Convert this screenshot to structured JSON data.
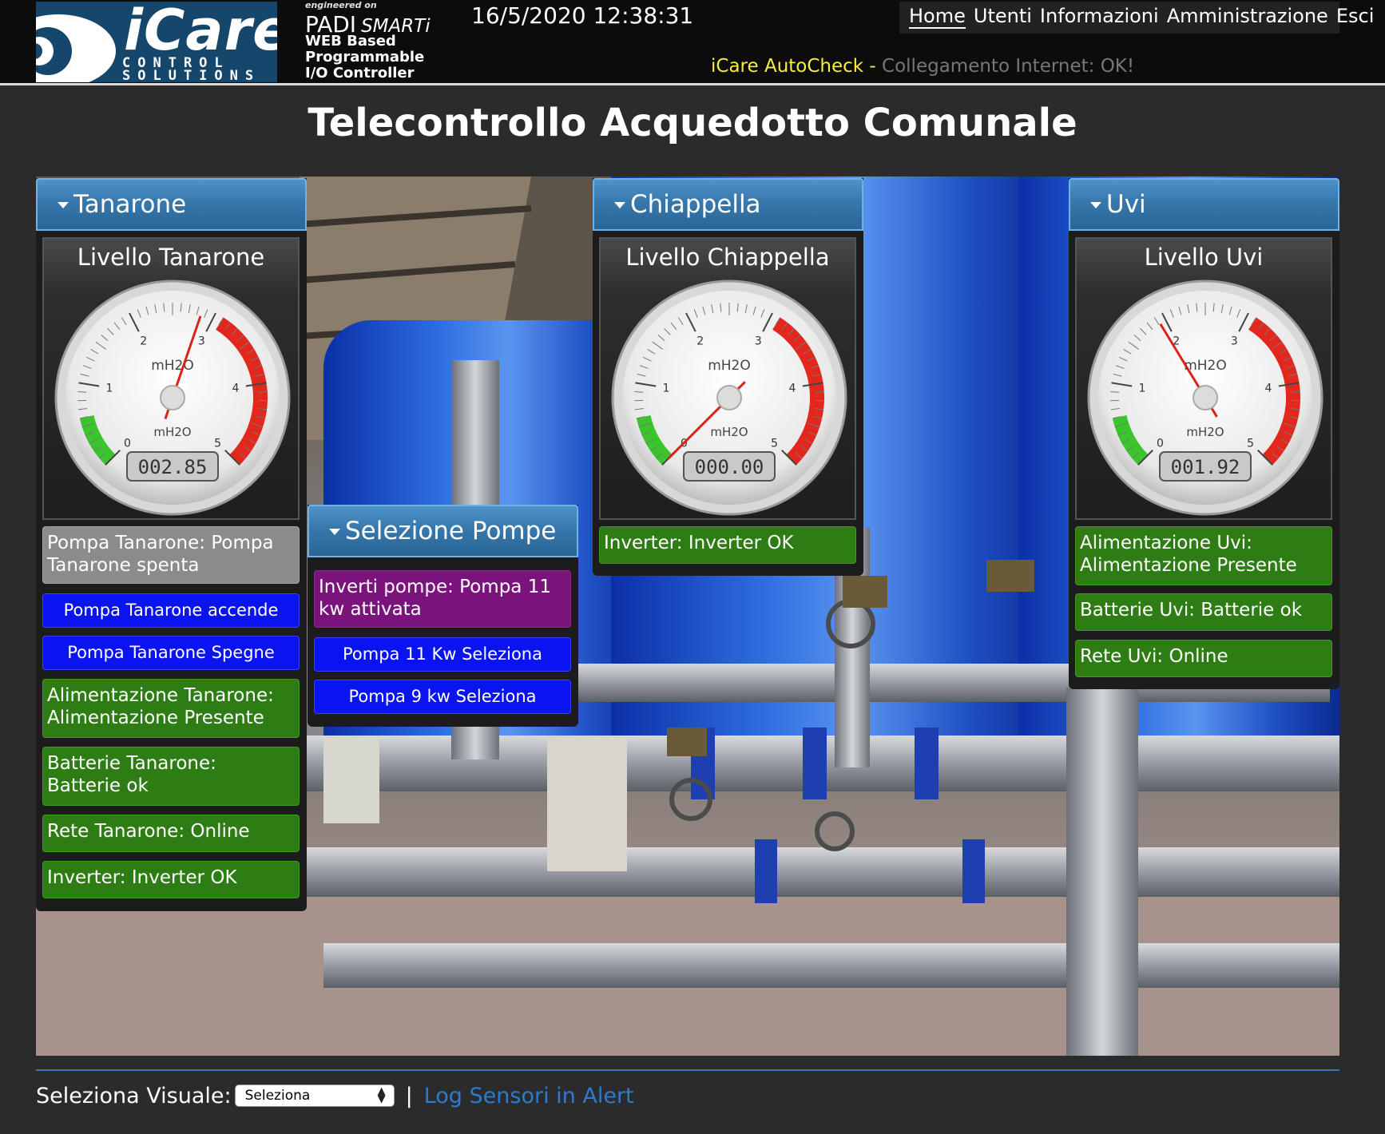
{
  "header": {
    "logo": {
      "name": "iCare",
      "sub1": "CONTROL",
      "sub2": "SOLUTIONS"
    },
    "padi": {
      "engineered": "engineered on",
      "name": "PADI",
      "smart": "SMARTi",
      "desc1": "WEB Based",
      "desc2": "Programmable",
      "desc3": "I/O Controller"
    },
    "datetime": "16/5/2020 12:38:31",
    "nav": [
      "Home",
      "Utenti",
      "Informazioni",
      "Amministrazione",
      "Esci"
    ],
    "autocheck": {
      "label": "iCare AutoCheck - ",
      "status": "Collegamento Internet: OK!"
    }
  },
  "page_title": "Telecontrollo Acquedotto Comunale",
  "panels": {
    "tanarone": {
      "title": "Tanarone",
      "gauge": {
        "title": "Livello Tanarone",
        "unit": "mH2O",
        "readout": "002.85",
        "value": 2.85,
        "min": 0,
        "max": 5
      },
      "pump_status": "Pompa Tanarone: Pompa Tanarone spenta",
      "btn_on": "Pompa Tanarone accende",
      "btn_off": "Pompa Tanarone Spegne",
      "power": "Alimentazione Tanarone: Alimentazione Presente",
      "battery": "Batterie Tanarone: Batterie ok",
      "network": "Rete Tanarone: Online",
      "inverter": "Inverter: Inverter OK"
    },
    "pompe": {
      "title": "Selezione Pompe",
      "invert": "Inverti pompe: Pompa 11 kw attivata",
      "btn_11": "Pompa 11 Kw Seleziona",
      "btn_9": "Pompa 9 kw Seleziona"
    },
    "chiappella": {
      "title": "Chiappella",
      "gauge": {
        "title": "Livello Chiappella",
        "unit": "mH2O",
        "readout": "000.00",
        "value": 0.0,
        "min": 0,
        "max": 5
      },
      "inverter": "Inverter: Inverter OK"
    },
    "uvi": {
      "title": "Uvi",
      "gauge": {
        "title": "Livello Uvi",
        "unit": "mH2O",
        "readout": "001.92",
        "value": 1.92,
        "min": 0,
        "max": 5
      },
      "power": "Alimentazione Uvi: Alimentazione Presente",
      "battery": "Batterie Uvi: Batterie ok",
      "network": "Rete Uvi: Online"
    }
  },
  "footer": {
    "label": "Seleziona Visuale:",
    "select_value": "Seleziona",
    "separator": "|",
    "link": "Log Sensori in Alert"
  },
  "colors": {
    "header_bg": "#0c0c0c",
    "panel_head": "#3778ac",
    "ok_green": "#2e7d14",
    "button_blue": "#0a14f0",
    "purple": "#7a137c",
    "autocheck_yellow": "#f7ef3a",
    "link_blue": "#2c7bd0"
  }
}
